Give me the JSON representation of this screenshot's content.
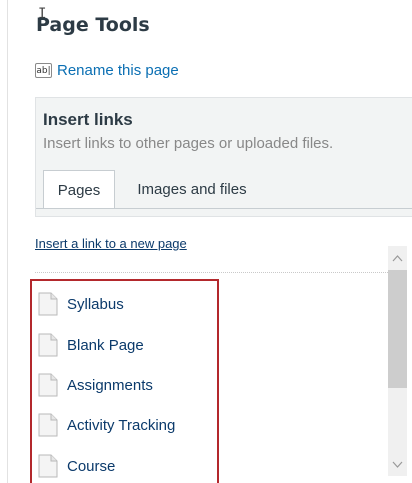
{
  "page_tools": {
    "title": "Page Tools",
    "rename": {
      "icon_text": "ab|",
      "label": "Rename this page"
    }
  },
  "insert_links": {
    "title": "Insert links",
    "subtitle": "Insert links to other pages or uploaded files.",
    "tabs": [
      {
        "label": "Pages",
        "active": true
      },
      {
        "label": "Images and files",
        "active": false
      }
    ],
    "new_page_link": "Insert a link to a new page",
    "pages": [
      {
        "label": "Syllabus"
      },
      {
        "label": "Blank Page"
      },
      {
        "label": "Assignments"
      },
      {
        "label": "Activity Tracking"
      },
      {
        "label": "Course"
      }
    ]
  },
  "colors": {
    "link": "#0b3a6b",
    "highlight_border": "#b3282c",
    "panel_bg": "#f2f4f4"
  }
}
